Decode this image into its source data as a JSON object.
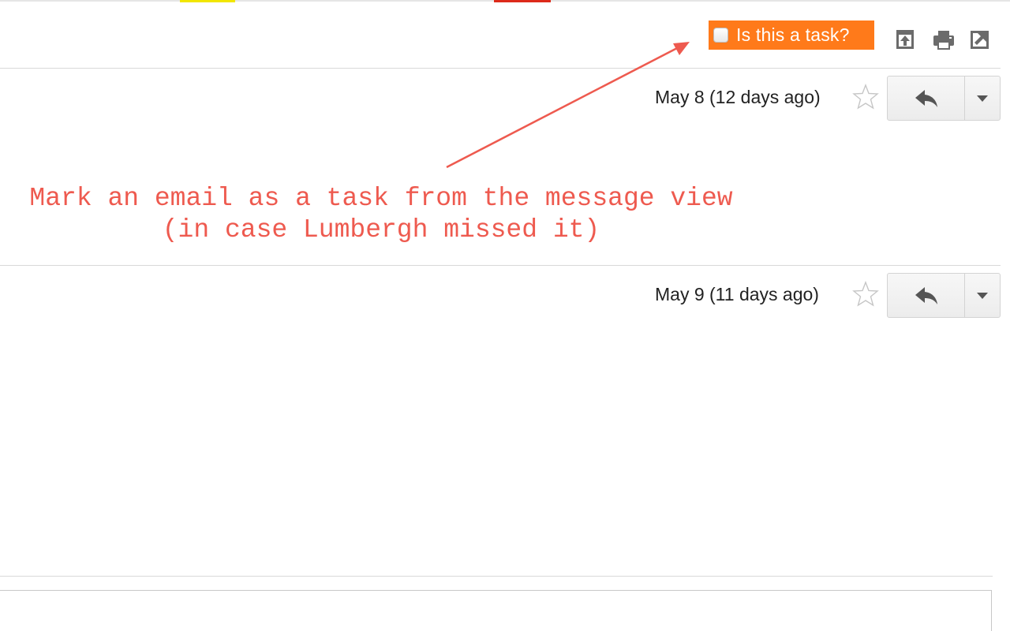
{
  "toolbar": {
    "task_toggle_label": "Is this a task?",
    "accent_color": "#ff7a1a"
  },
  "messages": [
    {
      "date": "May 8 (12 days ago)"
    },
    {
      "date": "May 9 (11 days ago)"
    }
  ],
  "annotation": {
    "line1": "Mark an email as a task from the message view",
    "line2": "(in case Lumbergh missed it)",
    "color": "#ee5a4f"
  },
  "icons": {
    "expand": "expand-all-icon",
    "print": "print-icon",
    "popout": "popout-icon",
    "star": "star-icon",
    "reply": "reply-icon",
    "more": "chevron-down-icon"
  }
}
